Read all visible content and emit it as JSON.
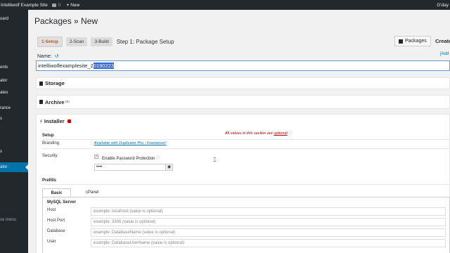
{
  "adminbar": {
    "site_name": "Intelliwolf Example Site",
    "comments_count": "0",
    "new_label": "New",
    "greeting": "G'day"
  },
  "sidebar": {
    "items": [
      "oard",
      "ents",
      "ator",
      "ates",
      "rance",
      "s",
      "s",
      "ator"
    ],
    "collapse_label": "se menu"
  },
  "page": {
    "title": "Packages » New",
    "steps": [
      "1-Setup",
      "2-Scan",
      "3-Build"
    ],
    "step_title": "Step 1: Package Setup",
    "packages_button": "Packages",
    "create_button": "Create N",
    "name_label": "Name:",
    "add_link": "[Add",
    "name_prefix": "intelliwolfexamplesite_2",
    "name_selected": "0190223"
  },
  "panels": {
    "storage": "Storage",
    "archive": "Archive",
    "archive_sup": "zip",
    "installer": "Installer"
  },
  "installer": {
    "all_values_text_1": "All values in this section are ",
    "all_values_link": "optional",
    "setup_heading": "Setup",
    "branding_label": "Branding",
    "branding_link": "Available with Duplicator Pro - Freelancer!",
    "security_label": "Security",
    "enable_password_label": "Enable Password Protection",
    "password_value": "••••",
    "prefills_heading": "Prefills",
    "tabs": [
      "Basic",
      "cPanel"
    ],
    "mysql_heading": "MySQL Server",
    "fields": [
      {
        "label": "Host",
        "placeholder": "example: localhost (value is optional)"
      },
      {
        "label": "Host Port",
        "placeholder": "example: 3306 (value is optional)"
      },
      {
        "label": "Database",
        "placeholder": "example: DatabaseName (value is optional)"
      },
      {
        "label": "User",
        "placeholder": "example: DatabaseUserName (value is optional)"
      }
    ]
  },
  "colors": {
    "adminbar_bg": "#23282d",
    "active_menu": "#0073aa",
    "selection": "#3367d6",
    "active_step": "#d54e21",
    "notice_red": "#aa0000"
  }
}
